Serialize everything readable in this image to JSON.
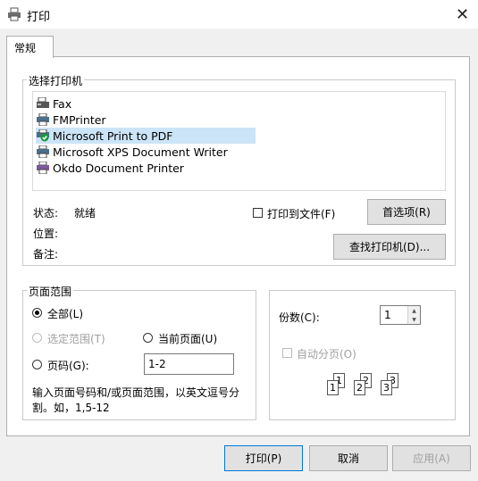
{
  "window": {
    "title": "打印",
    "close_symbol": "✕"
  },
  "tabs": [
    {
      "label": "常规"
    }
  ],
  "select_printer": {
    "label": "选择打印机",
    "printers": [
      {
        "name": "Fax",
        "icon": "fax-icon"
      },
      {
        "name": "FMPrinter",
        "icon": "printer-icon"
      },
      {
        "name": "Microsoft Print to PDF",
        "icon": "default-printer-icon",
        "selected": true
      },
      {
        "name": "Microsoft XPS Document Writer",
        "icon": "printer-icon"
      },
      {
        "name": "Okdo Document Printer",
        "icon": "printer-icon"
      }
    ],
    "status_label": "状态:",
    "status_value": "就绪",
    "location_label": "位置:",
    "comment_label": "备注:",
    "print_to_file_label": "打印到文件(F)",
    "print_to_file_checked": false,
    "preferences_button": "首选项(R)",
    "find_printer_button": "查找打印机(D)..."
  },
  "page_range": {
    "label": "页面范围",
    "all_label": "全部(L)",
    "selection_label": "选定范围(T)",
    "current_page_label": "当前页面(U)",
    "pages_label": "页码(G):",
    "pages_value": "1-2",
    "selected_option": "all",
    "help_line1": "输入页面号码和/或页面范围，以英文逗号分",
    "help_line2": "割。如，1,5-12"
  },
  "copies": {
    "label": "份数(C):",
    "value": "1",
    "collate_label": "自动分页(O)",
    "collate_checked": false,
    "collate_pages": [
      "1",
      "1",
      "2",
      "2",
      "3",
      "3"
    ]
  },
  "footer": {
    "print_button": "打印(P)",
    "cancel_button": "取消",
    "apply_button": "应用(A)"
  },
  "colors": {
    "selection": "#cce4f7",
    "accent": "#0078d7"
  }
}
